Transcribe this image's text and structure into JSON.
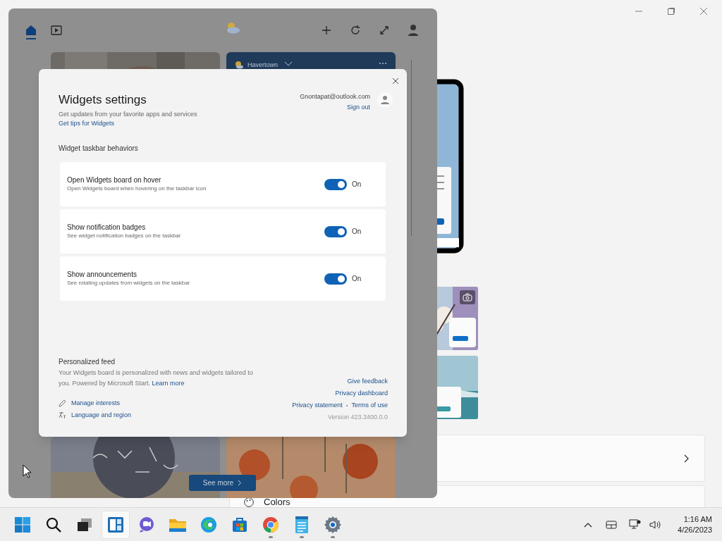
{
  "settings_window": {
    "rows": [
      {
        "kind": "blank"
      },
      {
        "kind": "labeled",
        "label": "Colors"
      }
    ]
  },
  "widgets_board": {
    "tabs": [
      {
        "kind": "home",
        "selected": true
      },
      {
        "kind": "video",
        "selected": false
      }
    ],
    "weather_card": {
      "location": "Havertown"
    },
    "see_more": "See more"
  },
  "dialog": {
    "title": "Widgets settings",
    "subtitle": "Get updates from your favorite apps and services",
    "tips_link": "Get tips for Widgets",
    "account": {
      "email": "Gnontapat@outlook.com",
      "sign_out": "Sign out"
    },
    "section_title": "Widget taskbar behaviors",
    "settings": [
      {
        "title": "Open Widgets board on hover",
        "description": "Open Widgets board when hovering on the taskbar icon",
        "on": true,
        "state_label": "On"
      },
      {
        "title": "Show notification badges",
        "description": "See widget notification badges on the taskbar",
        "on": true,
        "state_label": "On"
      },
      {
        "title": "Show announcements",
        "description": "See rotating updates from widgets on the taskbar",
        "on": true,
        "state_label": "On"
      }
    ],
    "feed": {
      "title": "Personalized feed",
      "description": "Your Widgets board is personalized with news and widgets tailored to you. Powered by Microsoft Start.",
      "learn_more": "Learn more",
      "actions": [
        {
          "kind": "pencil",
          "label": "Manage interests"
        },
        {
          "kind": "language",
          "label": "Language and region"
        }
      ]
    },
    "links": {
      "feedback": "Give feedback",
      "privacy_dashboard": "Privacy dashboard",
      "privacy_statement": "Privacy statement",
      "separator": "•",
      "terms": "Terms of use",
      "version": "Version 423.3400.0.0"
    }
  },
  "taskbar": {
    "apps": [
      {
        "kind": "start",
        "selected": false,
        "running": false
      },
      {
        "kind": "search",
        "selected": false,
        "running": false
      },
      {
        "kind": "taskview",
        "selected": false,
        "running": false
      },
      {
        "kind": "widgets",
        "selected": true,
        "running": false
      },
      {
        "kind": "chat",
        "selected": false,
        "running": false
      },
      {
        "kind": "explorer",
        "selected": false,
        "running": false
      },
      {
        "kind": "edge",
        "selected": false,
        "running": false
      },
      {
        "kind": "store",
        "selected": false,
        "running": false
      },
      {
        "kind": "chrome",
        "selected": false,
        "running": true
      },
      {
        "kind": "notepad",
        "selected": false,
        "running": true
      },
      {
        "kind": "settings",
        "selected": false,
        "running": true
      }
    ],
    "time": "1:16 AM",
    "date": "4/26/2023"
  }
}
